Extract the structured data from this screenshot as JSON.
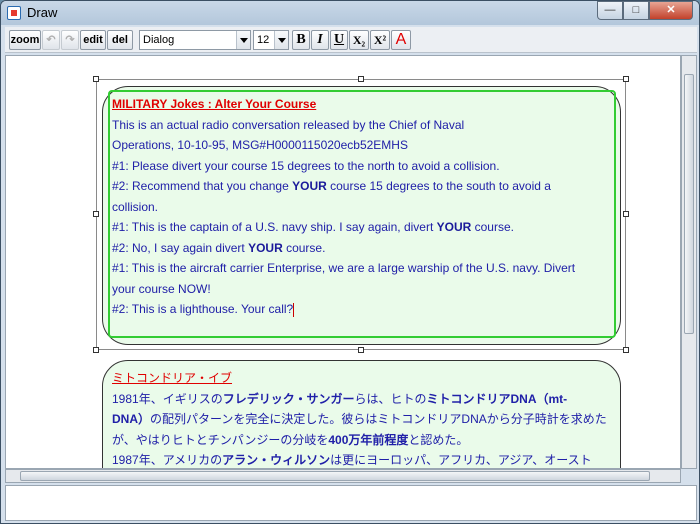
{
  "window": {
    "title": "Draw",
    "buttons": {
      "minimize": "—",
      "maximize": "□",
      "close": "✕"
    }
  },
  "toolbar": {
    "zoom": "zoom",
    "undo": "↶",
    "redo": "↷",
    "edit": "edit",
    "del": "del",
    "font": "Dialog",
    "size": "12",
    "bold": "B",
    "italic": "I",
    "underline": "U",
    "subscript": "X₂",
    "superscript": "X²",
    "color": "A"
  },
  "note1": {
    "title": "MILITARY Jokes : Alter Your Course",
    "lines": [
      [
        "This is an actual radio conversation released by the Chief of Naval"
      ],
      [
        "Operations, 10-10-95, MSG#H0000115020ecb52EMHS"
      ],
      [
        "#1: Please divert your course 15 degrees to the north to avoid a collision."
      ],
      [
        "#2: Recommend that you change ",
        "YOUR",
        " course 15 degrees to the south to avoid a"
      ],
      [
        "collision."
      ],
      [
        "#1: This is the captain of a U.S. navy ship. I say again, divert ",
        "YOUR",
        " course."
      ],
      [
        "#2: No, I say again divert ",
        "YOUR",
        " course."
      ],
      [
        "#1: This is the aircraft carrier Enterprise, we are a large warship of the U.S. navy. Divert"
      ],
      [
        "your course NOW!"
      ],
      [
        "#2: This is a lighthouse. Your call?"
      ]
    ]
  },
  "note2": {
    "title": "ミトコンドリア・イブ",
    "lines": [
      [
        "1981年、イギリスの",
        "フレデリック・サンガー",
        "らは、ヒトの",
        "ミトコンドリアDNA（mt-"
      ],
      [
        "DNA）",
        "の配列パターンを完全に決定した。彼らはミトコンドリアDNAから分子時計を求めた"
      ],
      [
        "が、やはりヒトとチンパンジーの分岐を",
        "400万年前程度",
        "と認めた。"
      ],
      [
        "1987年、アメリカの",
        "アラン・ウィルソン",
        "は更にヨーロッパ、アフリカ、アジア、オースト"
      ]
    ]
  }
}
